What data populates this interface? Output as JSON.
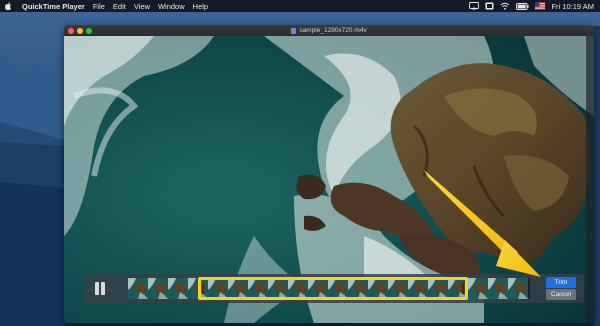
{
  "menubar": {
    "apple_icon": "apple-logo-icon",
    "app_name": "QuickTime Player",
    "items": [
      "File",
      "Edit",
      "View",
      "Window",
      "Help"
    ],
    "status_icons": [
      "cast-icon",
      "screen-mirror-icon",
      "wifi-icon",
      "battery-icon",
      "flag-icon"
    ],
    "clock": "Fri 10:19 AM"
  },
  "window": {
    "title": "sample_1280x720.m4v",
    "file_icon": "movie-file-icon"
  },
  "trim_bar": {
    "pause_icon": "pause-icon",
    "thumbnail_count": 20,
    "selection_start_fraction": 0.22,
    "selection_end_fraction": 0.89,
    "trim_label": "Trim",
    "cancel_label": "Cancel"
  },
  "colors": {
    "selection_border": "#f6d21c",
    "trim_button": "#1f6fe6",
    "annotation_arrow": "#f7c61a"
  }
}
